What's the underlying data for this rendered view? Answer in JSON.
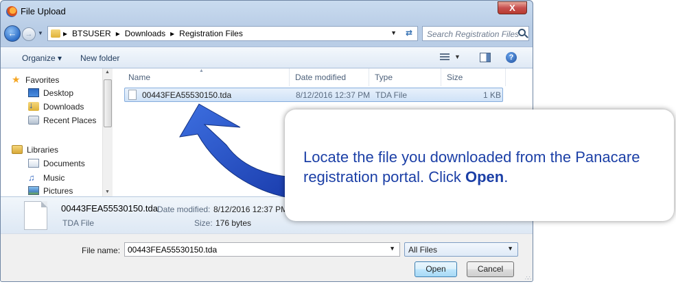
{
  "window": {
    "title": "File Upload",
    "close_label": "X"
  },
  "navbar": {
    "breadcrumbs": [
      "BTSUSER",
      "Downloads",
      "Registration Files"
    ],
    "search_placeholder": "Search Registration Files"
  },
  "toolbar": {
    "organize_label": "Organize ▾",
    "new_folder_label": "New folder"
  },
  "sidebar": {
    "items": [
      {
        "label": "Favorites",
        "icon": "star-icon"
      },
      {
        "label": "Desktop",
        "icon": "desktop-icon"
      },
      {
        "label": "Downloads",
        "icon": "downloads-icon"
      },
      {
        "label": "Recent Places",
        "icon": "recent-places-icon"
      },
      {
        "label": "Libraries",
        "icon": "libraries-icon"
      },
      {
        "label": "Documents",
        "icon": "documents-icon"
      },
      {
        "label": "Music",
        "icon": "music-icon"
      },
      {
        "label": "Pictures",
        "icon": "pictures-icon"
      }
    ]
  },
  "file_list": {
    "columns": [
      "Name",
      "Date modified",
      "Type",
      "Size"
    ],
    "rows": [
      {
        "name": "00443FEA55530150.tda",
        "date": "8/12/2016 12:37 PM",
        "type": "TDA File",
        "size": "1 KB"
      }
    ]
  },
  "details": {
    "filename": "00443FEA55530150.tda",
    "date_label": "Date modified:",
    "date_value": "8/12/2016 12:37 PM",
    "type": "TDA File",
    "size_label": "Size:",
    "size_value": "176 bytes"
  },
  "bottom": {
    "filename_label": "File name:",
    "filename_value": "00443FEA55530150.tda",
    "filetype_value": "All Files",
    "open_label": "Open",
    "cancel_label": "Cancel"
  },
  "callout": {
    "text_before": "Locate the file you downloaded from the Panacare registration portal. Click ",
    "text_bold": "Open",
    "text_after": ".",
    "color": "#1b3fa6"
  }
}
